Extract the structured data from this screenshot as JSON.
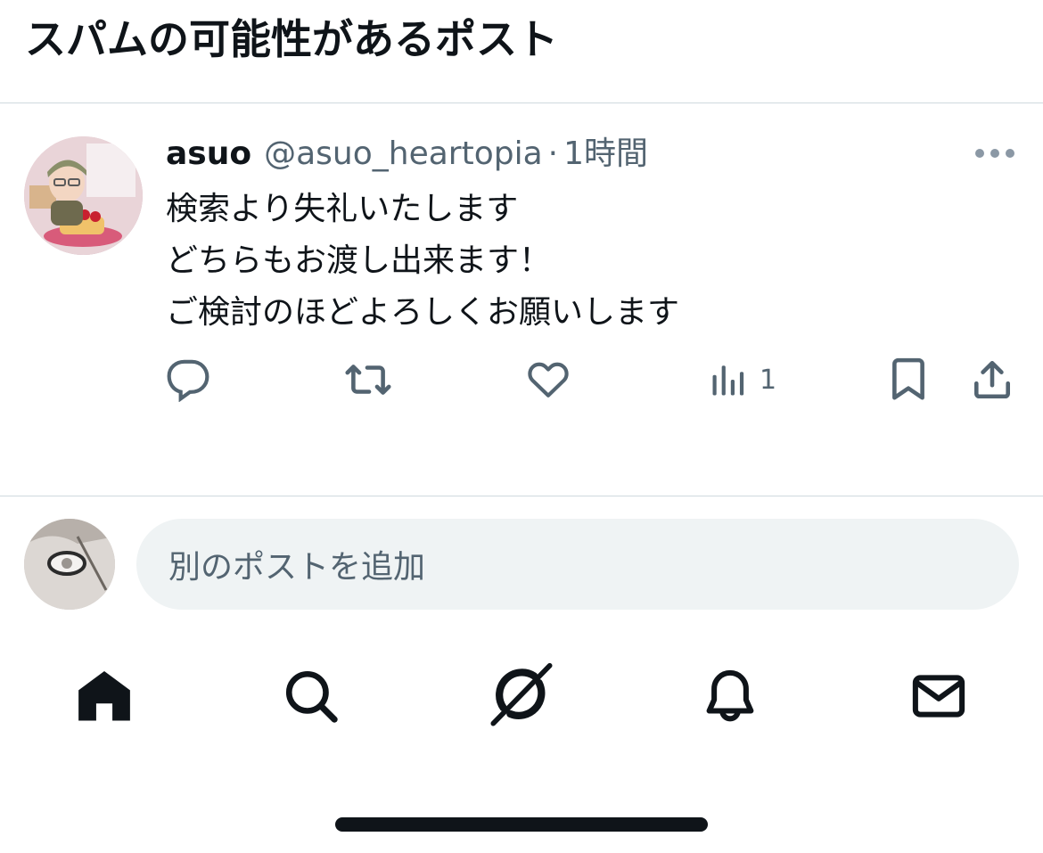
{
  "header": {
    "title": "スパムの可能性があるポスト"
  },
  "post": {
    "author_name": "asuo",
    "author_handle": "@asuo_heartopia",
    "separator": "·",
    "time": "1時間",
    "more_icon": "more-horizontal-icon",
    "body_lines": [
      "検索より失礼いたします",
      "どちらもお渡し出来ます！",
      "ご検討のほどよろしくお願いします"
    ],
    "actions": {
      "reply_icon": "reply-icon",
      "repost_icon": "repost-icon",
      "like_icon": "like-icon",
      "views_icon": "views-icon",
      "views_count": "1",
      "bookmark_icon": "bookmark-icon",
      "share_icon": "share-icon"
    }
  },
  "composer": {
    "placeholder": "別のポストを追加"
  },
  "bottom_nav": {
    "items": [
      {
        "name": "home",
        "icon": "home-icon",
        "active": true
      },
      {
        "name": "search",
        "icon": "search-icon",
        "active": false
      },
      {
        "name": "grok",
        "icon": "grok-icon",
        "active": false
      },
      {
        "name": "notifications",
        "icon": "bell-icon",
        "active": false
      },
      {
        "name": "messages",
        "icon": "mail-icon",
        "active": false
      }
    ]
  },
  "colors": {
    "text_primary": "#0f1419",
    "text_secondary": "#536471",
    "divider": "#cfd9de",
    "composer_bg": "#eff3f4"
  }
}
